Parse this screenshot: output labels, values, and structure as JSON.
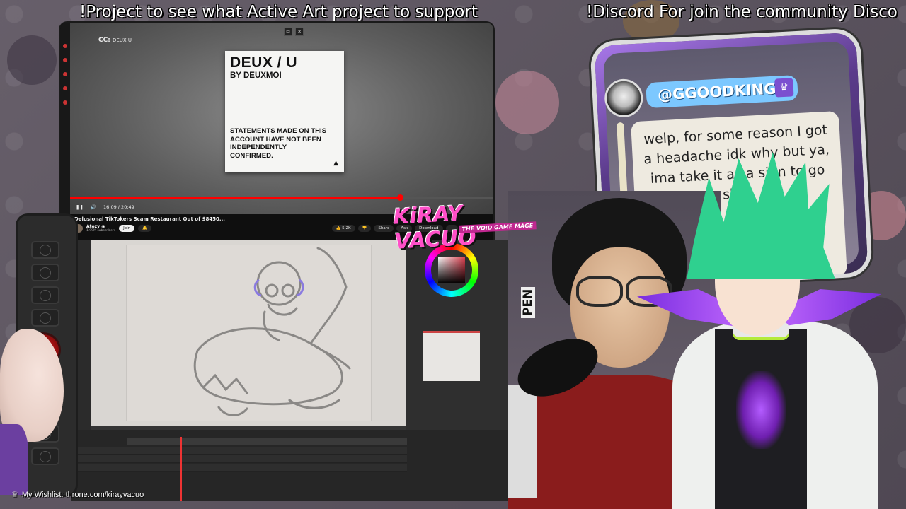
{
  "ticker": {
    "message_1": "!Project to see what Active Art project to support",
    "message_2": "!Discord For join the community Disco"
  },
  "youtube": {
    "cc_label": "CC:",
    "cc_channel": "DEUX U",
    "window_buttons": [
      "⧉",
      "✕"
    ],
    "card": {
      "title": "DEUX / U",
      "subtitle": "BY DEUXMOI",
      "body": "STATEMENTS MADE ON THIS ACCOUNT HAVE NOT BEEN INDEPENDENTLY CONFIRMED."
    },
    "progress_fraction": 0.78,
    "time": "16:09 / 20:49",
    "video_title": "Delusional TikTokers Scam Restaurant Out of $8450...",
    "channel_name": "Atozy ◉",
    "channel_subs": "1.99M subscribers",
    "join_label": "Join",
    "like_count": "5.2K",
    "share_label": "Share",
    "ask_label": "Ask",
    "download_label": "Download"
  },
  "logo": {
    "main": "KiRAY VACUO",
    "tagline": "THE VOID GAME MAGE"
  },
  "chat": {
    "username": "@GGOODKING2",
    "message": "welp, for some reason I got a headache idk why but ya, ima take it as a sign to go sle..."
  },
  "camera": {
    "pen_label": "PEN"
  },
  "wishlist": {
    "icon": "crown-icon",
    "text": "My Wishlist: throne.com/kirayvacuo"
  },
  "colors": {
    "ticker_text": "#ffffff",
    "logo_pink": "#ff4fc8",
    "chat_username_bg": "#7cc8ff",
    "youtube_red": "#ff0000",
    "vtuber_hair": "#2fd08f",
    "vtuber_purple": "#7a2de0"
  }
}
